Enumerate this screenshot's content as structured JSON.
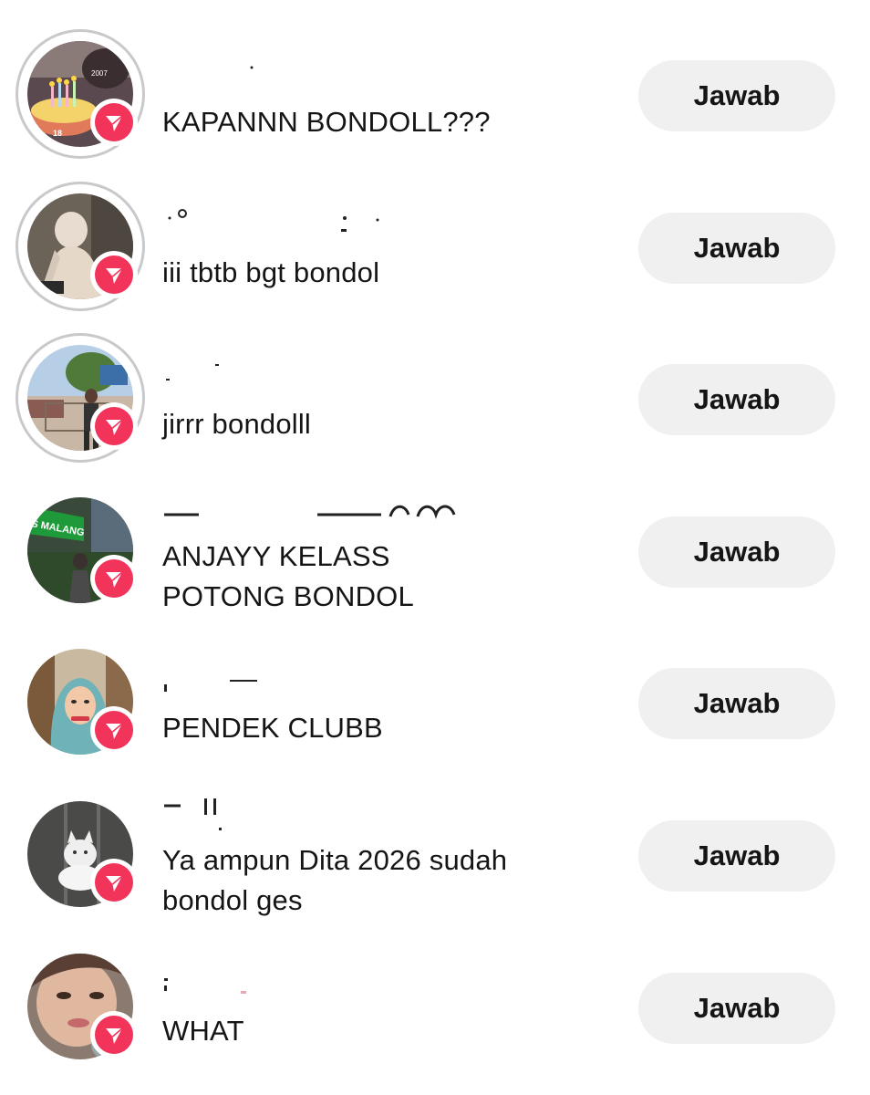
{
  "reply_label": "Jawab",
  "accent_color": "#f2335a",
  "badge_icon": "paper-plane-icon",
  "avatar_overlay_text": {
    "year": "2007",
    "age": "18",
    "sign": "S MALANG"
  },
  "items": [
    {
      "message_line1": "KAPANNN BONDOLL???",
      "message_line2": ""
    },
    {
      "message_line1": "iii tbtb bgt bondol",
      "message_line2": ""
    },
    {
      "message_line1": "jirrr bondolll",
      "message_line2": ""
    },
    {
      "message_line1": "ANJAYY KELASS",
      "message_line2": "POTONG BONDOL"
    },
    {
      "message_line1": "PENDEK CLUBB",
      "message_line2": ""
    },
    {
      "message_line1": "Ya ampun Dita 2026 sudah",
      "message_line2": "bondol ges"
    },
    {
      "message_line1": "WHAT",
      "message_line2": ""
    }
  ]
}
